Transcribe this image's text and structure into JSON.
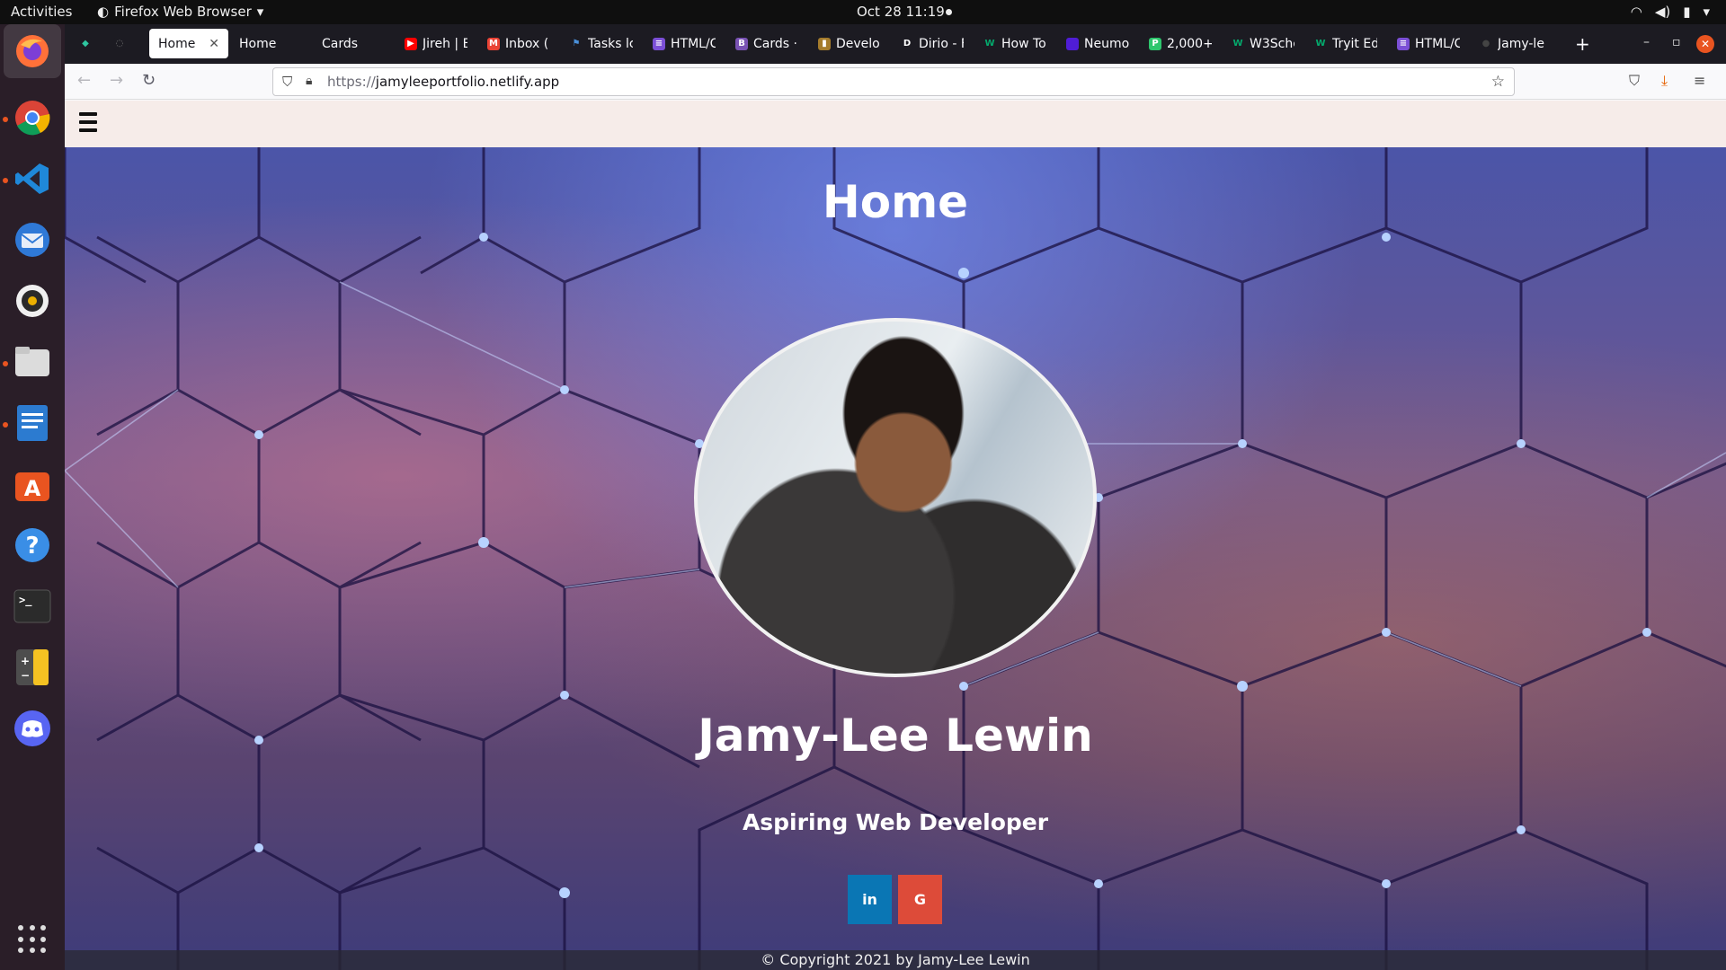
{
  "topbar": {
    "activities": "Activities",
    "app_name": "Firefox Web Browser",
    "clock": "Oct 28  11:19"
  },
  "dock": {
    "apps": [
      "firefox",
      "chrome",
      "vscode",
      "thunderbird",
      "rhythmbox",
      "files",
      "libreoffice-writer",
      "ubuntu-software",
      "help",
      "terminal",
      "calculator",
      "discord"
    ]
  },
  "browser": {
    "tabs": [
      {
        "title": "",
        "icon": "pinned-app-icon"
      },
      {
        "title": "",
        "icon": "refresh-loading-icon"
      },
      {
        "title": "Home",
        "selected": true
      },
      {
        "title": "Home"
      },
      {
        "title": "Cards"
      },
      {
        "title": "Jireh | E",
        "icon": "youtube-icon",
        "icon_color": "#ff0000"
      },
      {
        "title": "Inbox (",
        "icon": "gmail-icon",
        "icon_color": "#ea4335"
      },
      {
        "title": "Tasks lc",
        "icon": "flag-icon",
        "icon_color": "#4a90d9"
      },
      {
        "title": "HTML/C",
        "icon": "list-icon",
        "icon_color": "#7b4fd6"
      },
      {
        "title": "Cards ·",
        "icon": "bootstrap-icon",
        "icon_color": "#7952b3"
      },
      {
        "title": "Develo",
        "icon": "medium-icon",
        "icon_color": "#a57c2c"
      },
      {
        "title": "Dirio - F",
        "icon": "dirio-icon",
        "icon_color": "#222222"
      },
      {
        "title": "How To",
        "icon": "w3-icon",
        "icon_color": "#04aa6d"
      },
      {
        "title": "Neumo",
        "icon": "neumorphism-icon",
        "icon_color": "#4f1dd6"
      },
      {
        "title": "2,000+",
        "icon": "pixabay-icon",
        "icon_color": "#2ec66d"
      },
      {
        "title": "W3Schc",
        "icon": "w3-icon",
        "icon_color": "#04aa6d"
      },
      {
        "title": "Tryit Ed",
        "icon": "w3-icon",
        "icon_color": "#04aa6d"
      },
      {
        "title": "HTML/C",
        "icon": "list-icon",
        "icon_color": "#7b4fd6"
      },
      {
        "title": "Jamy-le",
        "icon": "github-icon",
        "icon_color": "#222222"
      }
    ],
    "url_scheme": "https://",
    "url_host": "jamyleeportfolio.netlify.app"
  },
  "page": {
    "hero_title": "Home",
    "name": "Jamy-Lee Lewin",
    "tagline": "Aspiring Web Developer",
    "social": {
      "linkedin": "in",
      "google": "G",
      "linkedin_color": "#0a76b4",
      "google_color": "#dd4b39"
    },
    "footer": "© Copyright 2021 by Jamy-Lee Lewin"
  }
}
